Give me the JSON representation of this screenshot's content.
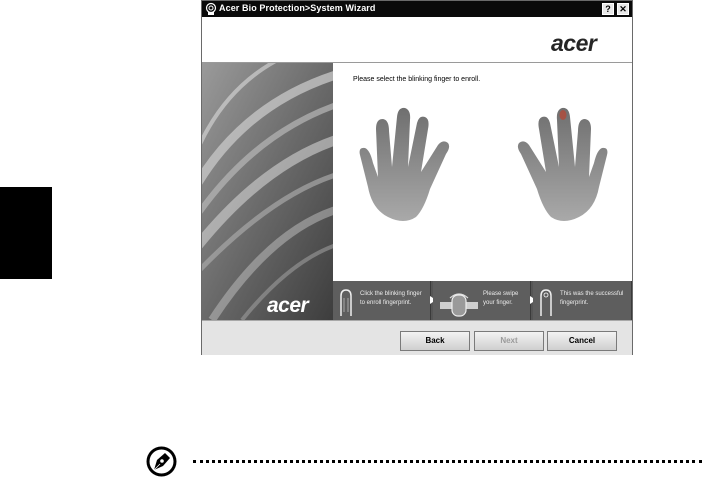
{
  "window": {
    "title": "Acer Bio Protection>System Wizard",
    "help_button": "?",
    "close_button": "✕",
    "header_logo": "acer",
    "panel_logo": "acer"
  },
  "content": {
    "instruction": "Please select the blinking finger to enroll."
  },
  "steps": [
    {
      "text": "Click the blinking finger to enroll fingerprint."
    },
    {
      "text": "Please swipe your finger."
    },
    {
      "text": "This was the successful fingerprint."
    }
  ],
  "buttons": {
    "back": "Back",
    "next": "Next",
    "cancel": "Cancel"
  },
  "colors": {
    "titlebar": "#0a0a0a",
    "hand_fill": "#8a8a8a",
    "step_bg": "#5e5e5e"
  }
}
